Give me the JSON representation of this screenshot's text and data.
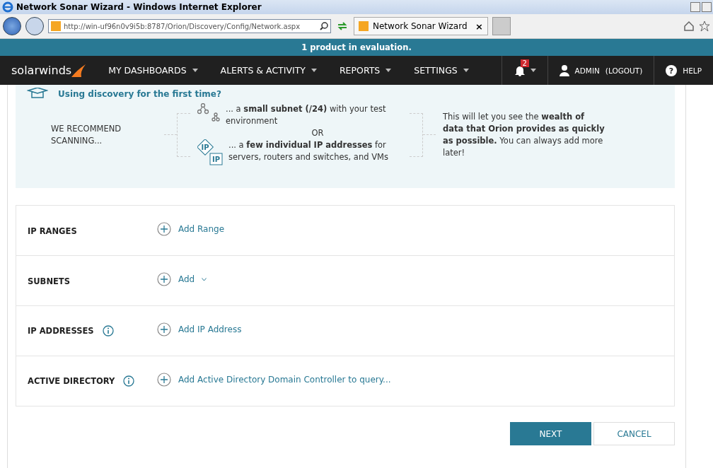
{
  "window": {
    "title": "Network Sonar Wizard - Windows Internet Explorer"
  },
  "browser": {
    "address": "http://win-uf96n0v9i5b:8787/Orion/Discovery/Config/Network.aspx",
    "tab": "Network Sonar Wizard",
    "tab_close": "×"
  },
  "banner": "1 product in evaluation.",
  "nav": {
    "logo": "solarwinds",
    "menus": [
      "MY DASHBOARDS",
      "ALERTS & ACTIVITY",
      "REPORTS",
      "SETTINGS"
    ],
    "alert_count": "2",
    "user": "ADMIN",
    "logout": "(LOGOUT)",
    "help": "HELP",
    "help_symbol": "?"
  },
  "intro": {
    "title": "Using discovery for the first time?",
    "recommend": "WE RECOMMEND SCANNING...",
    "options": [
      {
        "kind": "subnet",
        "text": "... a **small subnet (/24)** with your test environment"
      },
      {
        "kind": "ip",
        "badges": [
          "IP",
          "IP"
        ],
        "text": "... a **few individual IP addresses** for servers, routers and switches, and VMs"
      }
    ],
    "separator": "OR",
    "note": "This will let you see the **wealth of data that Orion provides as quickly as possible.** You can always add more later!"
  },
  "sections": [
    {
      "label": "IP RANGES",
      "info": false,
      "action": "Add Range",
      "dropdown": false
    },
    {
      "label": "SUBNETS",
      "info": false,
      "action": "Add",
      "dropdown": true
    },
    {
      "label": "IP ADDRESSES",
      "info": true,
      "action": "Add IP Address",
      "dropdown": false
    },
    {
      "label": "ACTIVE DIRECTORY",
      "info": true,
      "action": "Add Active Directory Domain Controller to query...",
      "dropdown": false
    }
  ],
  "buttons": [
    {
      "label": "NEXT",
      "kind": "primary"
    },
    {
      "label": "CANCEL",
      "kind": "secondary"
    }
  ]
}
